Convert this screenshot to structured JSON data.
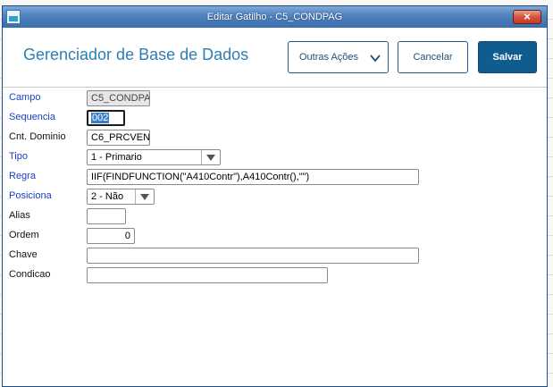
{
  "window": {
    "title": "Editar Gatilho - C5_CONDPAG",
    "close_glyph": "×"
  },
  "header": {
    "title": "Gerenciador de Base de Dados",
    "actions_label": "Outras Ações",
    "cancel_label": "Cancelar",
    "save_label": "Salvar"
  },
  "form": {
    "campo": {
      "label": "Campo",
      "value": "C5_CONDPA"
    },
    "sequencia": {
      "label": "Sequencia",
      "value": "002"
    },
    "cnt_dominio": {
      "label": "Cnt. Dominio",
      "value": "C6_PRCVEN"
    },
    "tipo": {
      "label": "Tipo",
      "value": "1 - Primario"
    },
    "regra": {
      "label": "Regra",
      "value": "IIF(FINDFUNCTION(\"A410Contr\"),A410Contr(),\"\")"
    },
    "posiciona": {
      "label": "Posiciona",
      "value": "2 - Não"
    },
    "alias": {
      "label": "Alias",
      "value": ""
    },
    "ordem": {
      "label": "Ordem",
      "value": "0"
    },
    "chave": {
      "label": "Chave",
      "value": ""
    },
    "condicao": {
      "label": "Condicao",
      "value": ""
    }
  },
  "icons": {
    "app": "app-window-icon",
    "close": "close-icon",
    "actions": "chevron-down-icon",
    "select": "dropdown-triangle-icon"
  },
  "colors": {
    "accent": "#2a7fb5",
    "save_button": "#0f5d8f",
    "required_label": "#1c3fc4",
    "titlebar": "#4f82bf"
  }
}
